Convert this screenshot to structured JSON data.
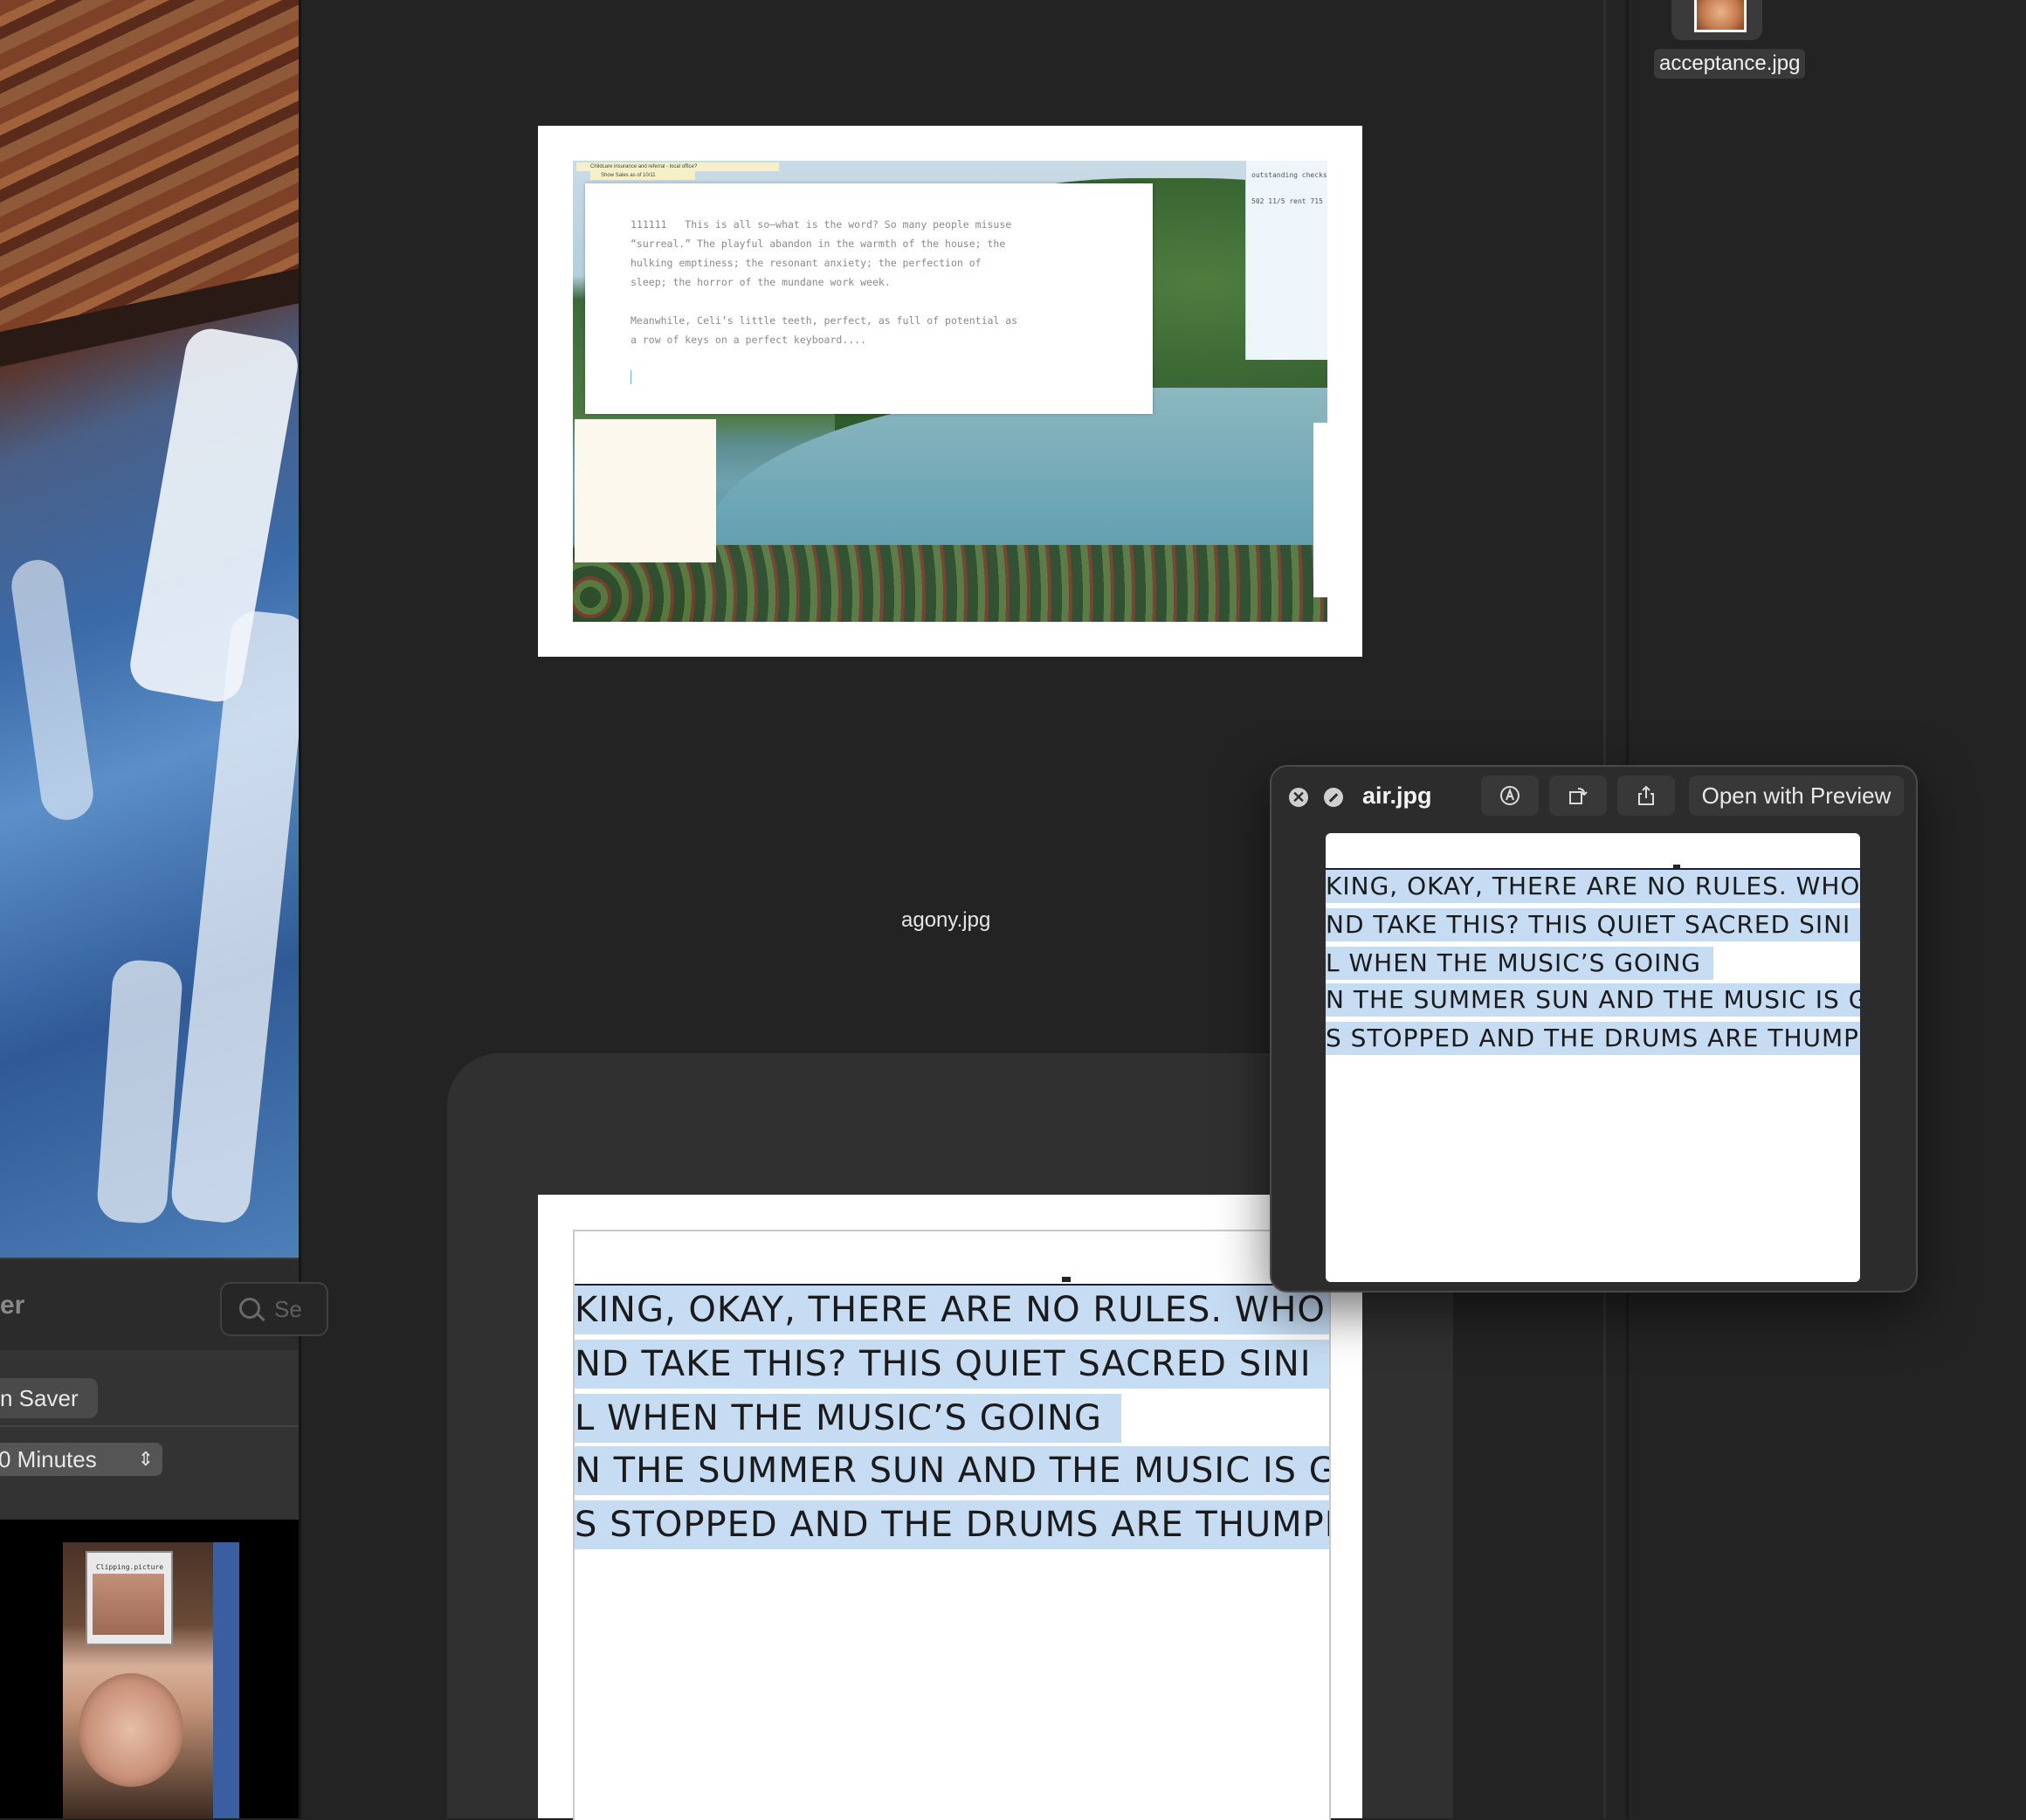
{
  "left_panel": {
    "title_partial": "er",
    "search_placeholder": "Se",
    "saver_label": "n Saver",
    "minutes_value": "0 Minutes",
    "portrait_window_title": "Clipping.picture"
  },
  "right_column": {
    "file_label": "acceptance.jpg"
  },
  "agony_card": {
    "label": "agony.jpg",
    "window_text": "111111   This is all so—what is the word? So many people misuse\n“surreal.” The playful abandon in the warmth of the house; the\nhulking emptiness; the resonant anxiety; the perfection of\nsleep; the horror of the mundane work week.\n\nMeanwhile, Celi’s little teeth, perfect, as full of potential as\na row of keys on a perfect keyboard....",
    "tab1_text": "Childcare insurance and referral - local office?",
    "tab2_text": "Show Sales as of 10/11",
    "side_title": "outstanding checks",
    "side_line": "502 11/5 rent 715"
  },
  "document_lines": [
    "KING, OKAY, THERE ARE NO RULES. WHO",
    "ND TAKE THIS? THIS QUIET SACRED SINI",
    "L WHEN THE MUSIC’S GOING",
    "N THE SUMMER SUN AND THE MUSIC IS G",
    "S STOPPED AND THE DRUMS ARE THUMPI"
  ],
  "quicklook": {
    "title": "air.jpg",
    "open_button": "Open with Preview",
    "close_glyph": "✕"
  },
  "colors": {
    "background": "#232323",
    "highlight": "#c5dcf2",
    "panel": "#2c2c2c"
  }
}
